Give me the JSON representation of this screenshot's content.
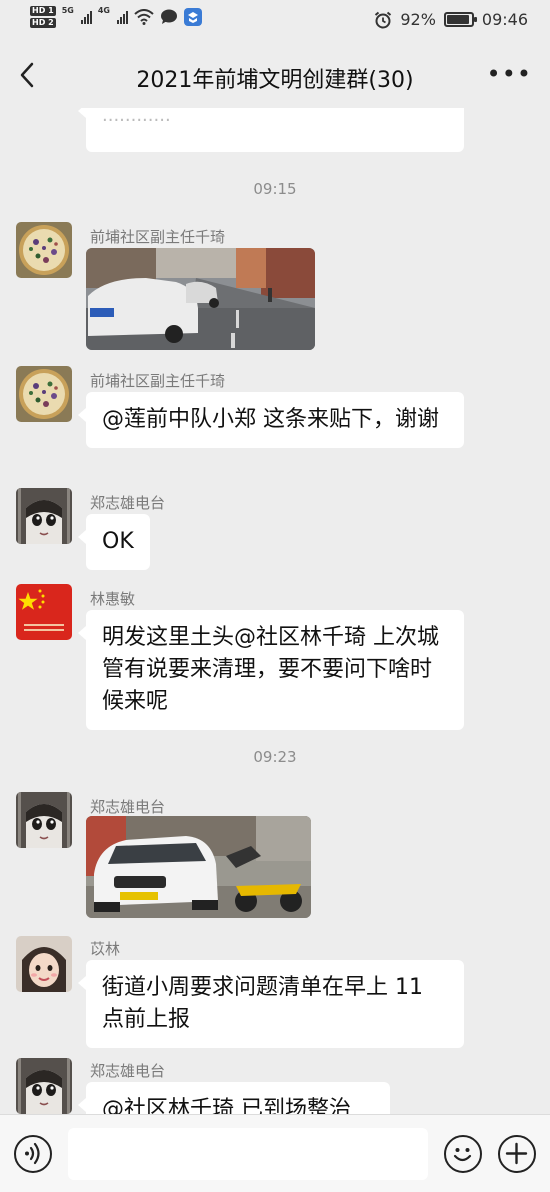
{
  "status_bar": {
    "sim1": "HD 1",
    "sim2": "HD 2",
    "net1": "5G",
    "net2": "4G",
    "battery_percent": "92%",
    "battery_level": 0.92,
    "time": "09:46"
  },
  "nav": {
    "title": "2021年前埔文明创建群(30)"
  },
  "chat": {
    "time_markers": [
      "09:15",
      "09:23"
    ],
    "messages": [
      {
        "sender": "",
        "type": "text",
        "text": ""
      },
      {
        "sender": "前埔社区副主任千琦",
        "type": "image",
        "image_desc": "street-photo"
      },
      {
        "sender": "前埔社区副主任千琦",
        "type": "text",
        "text": "@莲前中队小郑  这条来贴下，谢谢"
      },
      {
        "sender": "郑志雄电台",
        "type": "text",
        "text": "OK"
      },
      {
        "sender": "林惠敏",
        "type": "text",
        "text": "明发这里土头@社区林千琦  上次城管有说要来清理，要不要问下啥时候来呢"
      },
      {
        "sender": "郑志雄电台",
        "type": "image",
        "image_desc": "car-photo"
      },
      {
        "sender": "苡林",
        "type": "text",
        "text": "街道小周要求问题清单在早上 11 点前上报"
      },
      {
        "sender": "郑志雄电台",
        "type": "text",
        "text": "@社区林千琦  已到场整治"
      }
    ],
    "partial_top_text": "............"
  },
  "input_bar": {
    "placeholder": "",
    "voice_icon": "voice-icon",
    "emoji_icon": "emoji-icon",
    "plus_icon": "plus-icon"
  },
  "colors": {
    "background": "#ededed",
    "bubble": "#ffffff",
    "time_label": "#8c8c8c",
    "sender": "#7a7a7a"
  }
}
